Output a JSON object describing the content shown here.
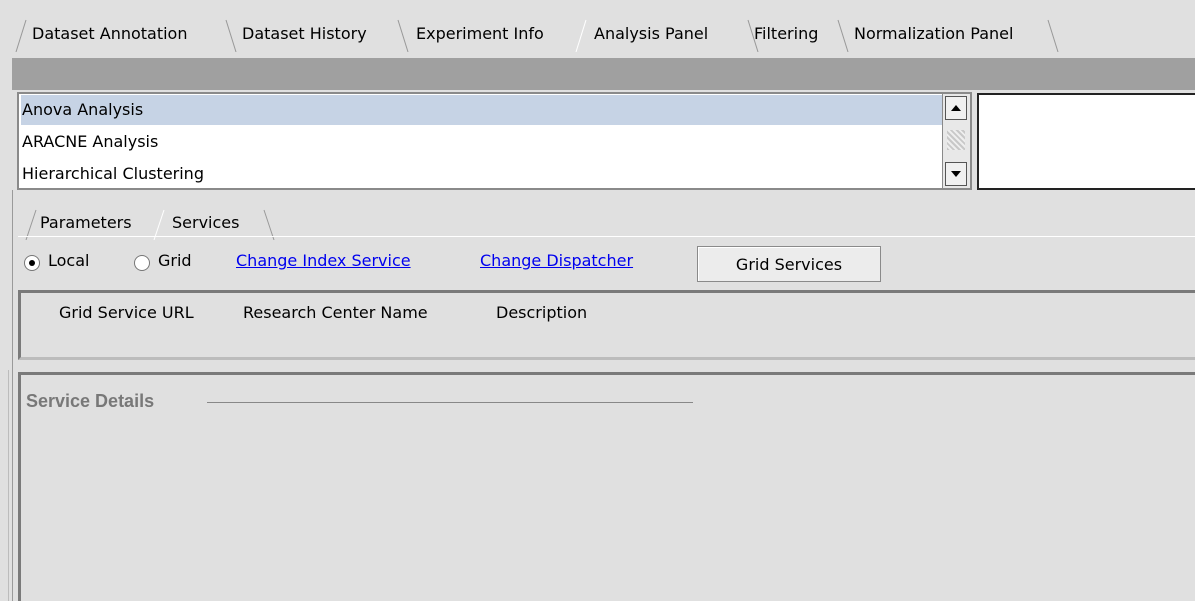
{
  "top_tabs": [
    {
      "label": "Dataset Annotation"
    },
    {
      "label": "Dataset History"
    },
    {
      "label": "Experiment Info"
    },
    {
      "label": "Analysis Panel",
      "selected": true
    },
    {
      "label": "Filtering"
    },
    {
      "label": "Normalization Panel"
    }
  ],
  "analysis_list": {
    "items": [
      {
        "label": "Anova Analysis",
        "selected": true
      },
      {
        "label": "ARACNE Analysis"
      },
      {
        "label": "Hierarchical Clustering"
      }
    ]
  },
  "sub_tabs": [
    {
      "label": "Parameters"
    },
    {
      "label": "Services",
      "selected": true
    }
  ],
  "services": {
    "radio_local": "Local",
    "radio_grid": "Grid",
    "selected_mode": "Local",
    "link_change_index": "Change Index Service",
    "link_change_dispatcher": "Change Dispatcher",
    "button_grid_services": "Grid Services",
    "table_columns": [
      "Grid Service URL",
      "Research Center Name",
      "Description"
    ],
    "details_title": "Service Details"
  },
  "colors": {
    "selection": "#c6d3e5",
    "link": "#0000ee",
    "panel_bg": "#e0e0e0",
    "dark_bar": "#a0a0a0"
  }
}
